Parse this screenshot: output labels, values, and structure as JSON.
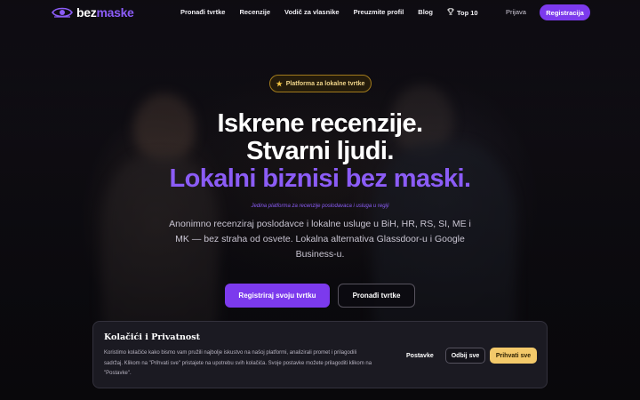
{
  "brand": {
    "part1": "bez",
    "part2": "maske",
    "accent_color": "#8b5cf6"
  },
  "nav": {
    "links": [
      "Pronađi tvrtke",
      "Recenzije",
      "Vodič za vlasnike",
      "Preuzmite profil",
      "Blog",
      "Top 10"
    ],
    "top10_icon": "trophy-icon",
    "login": "Prijava",
    "signup": "Registracija"
  },
  "hero": {
    "badge": "Platforma za lokalne tvrtke",
    "badge_icon": "star-icon",
    "headline_1": "Iskrene recenzije.",
    "headline_2": "Stvarni ljudi.",
    "headline_3": "Lokalni biznisi bez maski.",
    "tagline": "Jedina platforma za recenzije poslodavaca i usluga u regiji",
    "description": "Anonimno recenziraj poslodavce i lokalne usluge u BiH, HR, RS, SI, ME i MK — bez straha od osvete. Lokalna alternativa Glassdoor-u i Google Business-u.",
    "primary_cta": "Registriraj svoju tvrtku",
    "secondary_cta": "Pronađi tvrtke"
  },
  "cookie": {
    "title": "Kolačići i Privatnost",
    "text": "Koristimo kolačiće kako bismo vam pružili najbolje iskustvo na našoj platformi, analizirali promet i prilagodili sadržaj. Klikom na \"Prihvati sve\" pristajete na upotrebu svih kolačića. Svoje postavke možete prilagoditi klikom na \"Postavke\".",
    "settings": "Postavke",
    "reject": "Odbij sve",
    "accept": "Prihvati sve"
  }
}
